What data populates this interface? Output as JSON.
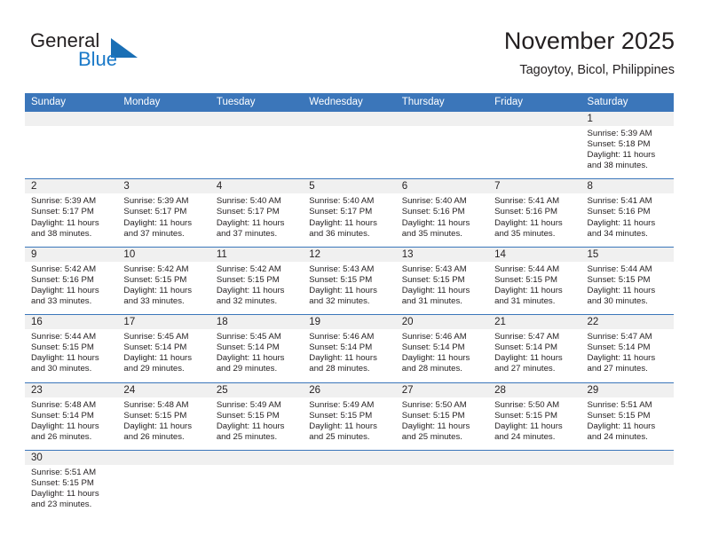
{
  "brand": {
    "name_top": "General",
    "name_bottom": "Blue",
    "triangle_color": "#1a6fb5",
    "blue_color": "#1a79c8"
  },
  "header": {
    "title": "November 2025",
    "location": "Tagoytoy, Bicol, Philippines"
  },
  "colors": {
    "header_blue": "#3b76ba",
    "daynum_bg": "#f0f0f0",
    "text": "#231f20"
  },
  "calendar": {
    "weekdays": [
      "Sunday",
      "Monday",
      "Tuesday",
      "Wednesday",
      "Thursday",
      "Friday",
      "Saturday"
    ],
    "weeks": [
      [
        {
          "day": "",
          "empty": true
        },
        {
          "day": "",
          "empty": true
        },
        {
          "day": "",
          "empty": true
        },
        {
          "day": "",
          "empty": true
        },
        {
          "day": "",
          "empty": true
        },
        {
          "day": "",
          "empty": true
        },
        {
          "day": "1",
          "sunrise": "Sunrise: 5:39 AM",
          "sunset": "Sunset: 5:18 PM",
          "daylight": "Daylight: 11 hours and 38 minutes."
        }
      ],
      [
        {
          "day": "2",
          "sunrise": "Sunrise: 5:39 AM",
          "sunset": "Sunset: 5:17 PM",
          "daylight": "Daylight: 11 hours and 38 minutes."
        },
        {
          "day": "3",
          "sunrise": "Sunrise: 5:39 AM",
          "sunset": "Sunset: 5:17 PM",
          "daylight": "Daylight: 11 hours and 37 minutes."
        },
        {
          "day": "4",
          "sunrise": "Sunrise: 5:40 AM",
          "sunset": "Sunset: 5:17 PM",
          "daylight": "Daylight: 11 hours and 37 minutes."
        },
        {
          "day": "5",
          "sunrise": "Sunrise: 5:40 AM",
          "sunset": "Sunset: 5:17 PM",
          "daylight": "Daylight: 11 hours and 36 minutes."
        },
        {
          "day": "6",
          "sunrise": "Sunrise: 5:40 AM",
          "sunset": "Sunset: 5:16 PM",
          "daylight": "Daylight: 11 hours and 35 minutes."
        },
        {
          "day": "7",
          "sunrise": "Sunrise: 5:41 AM",
          "sunset": "Sunset: 5:16 PM",
          "daylight": "Daylight: 11 hours and 35 minutes."
        },
        {
          "day": "8",
          "sunrise": "Sunrise: 5:41 AM",
          "sunset": "Sunset: 5:16 PM",
          "daylight": "Daylight: 11 hours and 34 minutes."
        }
      ],
      [
        {
          "day": "9",
          "sunrise": "Sunrise: 5:42 AM",
          "sunset": "Sunset: 5:16 PM",
          "daylight": "Daylight: 11 hours and 33 minutes."
        },
        {
          "day": "10",
          "sunrise": "Sunrise: 5:42 AM",
          "sunset": "Sunset: 5:15 PM",
          "daylight": "Daylight: 11 hours and 33 minutes."
        },
        {
          "day": "11",
          "sunrise": "Sunrise: 5:42 AM",
          "sunset": "Sunset: 5:15 PM",
          "daylight": "Daylight: 11 hours and 32 minutes."
        },
        {
          "day": "12",
          "sunrise": "Sunrise: 5:43 AM",
          "sunset": "Sunset: 5:15 PM",
          "daylight": "Daylight: 11 hours and 32 minutes."
        },
        {
          "day": "13",
          "sunrise": "Sunrise: 5:43 AM",
          "sunset": "Sunset: 5:15 PM",
          "daylight": "Daylight: 11 hours and 31 minutes."
        },
        {
          "day": "14",
          "sunrise": "Sunrise: 5:44 AM",
          "sunset": "Sunset: 5:15 PM",
          "daylight": "Daylight: 11 hours and 31 minutes."
        },
        {
          "day": "15",
          "sunrise": "Sunrise: 5:44 AM",
          "sunset": "Sunset: 5:15 PM",
          "daylight": "Daylight: 11 hours and 30 minutes."
        }
      ],
      [
        {
          "day": "16",
          "sunrise": "Sunrise: 5:44 AM",
          "sunset": "Sunset: 5:15 PM",
          "daylight": "Daylight: 11 hours and 30 minutes."
        },
        {
          "day": "17",
          "sunrise": "Sunrise: 5:45 AM",
          "sunset": "Sunset: 5:14 PM",
          "daylight": "Daylight: 11 hours and 29 minutes."
        },
        {
          "day": "18",
          "sunrise": "Sunrise: 5:45 AM",
          "sunset": "Sunset: 5:14 PM",
          "daylight": "Daylight: 11 hours and 29 minutes."
        },
        {
          "day": "19",
          "sunrise": "Sunrise: 5:46 AM",
          "sunset": "Sunset: 5:14 PM",
          "daylight": "Daylight: 11 hours and 28 minutes."
        },
        {
          "day": "20",
          "sunrise": "Sunrise: 5:46 AM",
          "sunset": "Sunset: 5:14 PM",
          "daylight": "Daylight: 11 hours and 28 minutes."
        },
        {
          "day": "21",
          "sunrise": "Sunrise: 5:47 AM",
          "sunset": "Sunset: 5:14 PM",
          "daylight": "Daylight: 11 hours and 27 minutes."
        },
        {
          "day": "22",
          "sunrise": "Sunrise: 5:47 AM",
          "sunset": "Sunset: 5:14 PM",
          "daylight": "Daylight: 11 hours and 27 minutes."
        }
      ],
      [
        {
          "day": "23",
          "sunrise": "Sunrise: 5:48 AM",
          "sunset": "Sunset: 5:14 PM",
          "daylight": "Daylight: 11 hours and 26 minutes."
        },
        {
          "day": "24",
          "sunrise": "Sunrise: 5:48 AM",
          "sunset": "Sunset: 5:15 PM",
          "daylight": "Daylight: 11 hours and 26 minutes."
        },
        {
          "day": "25",
          "sunrise": "Sunrise: 5:49 AM",
          "sunset": "Sunset: 5:15 PM",
          "daylight": "Daylight: 11 hours and 25 minutes."
        },
        {
          "day": "26",
          "sunrise": "Sunrise: 5:49 AM",
          "sunset": "Sunset: 5:15 PM",
          "daylight": "Daylight: 11 hours and 25 minutes."
        },
        {
          "day": "27",
          "sunrise": "Sunrise: 5:50 AM",
          "sunset": "Sunset: 5:15 PM",
          "daylight": "Daylight: 11 hours and 25 minutes."
        },
        {
          "day": "28",
          "sunrise": "Sunrise: 5:50 AM",
          "sunset": "Sunset: 5:15 PM",
          "daylight": "Daylight: 11 hours and 24 minutes."
        },
        {
          "day": "29",
          "sunrise": "Sunrise: 5:51 AM",
          "sunset": "Sunset: 5:15 PM",
          "daylight": "Daylight: 11 hours and 24 minutes."
        }
      ],
      [
        {
          "day": "30",
          "sunrise": "Sunrise: 5:51 AM",
          "sunset": "Sunset: 5:15 PM",
          "daylight": "Daylight: 11 hours and 23 minutes."
        },
        {
          "day": "",
          "empty": true
        },
        {
          "day": "",
          "empty": true
        },
        {
          "day": "",
          "empty": true
        },
        {
          "day": "",
          "empty": true
        },
        {
          "day": "",
          "empty": true
        },
        {
          "day": "",
          "empty": true
        }
      ]
    ]
  }
}
